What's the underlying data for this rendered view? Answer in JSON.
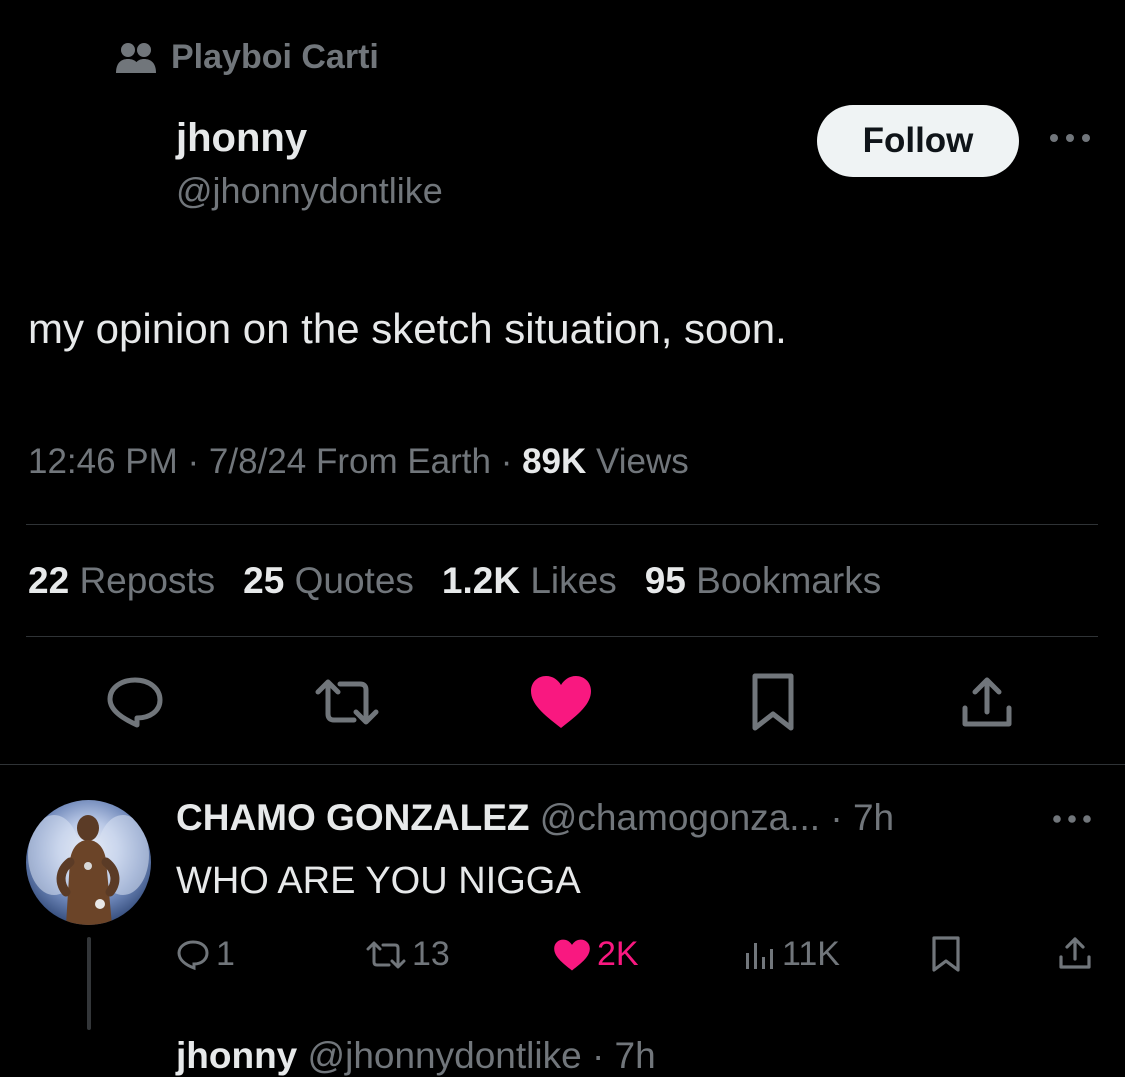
{
  "community": {
    "label": "Playboi Carti",
    "icon": "people-icon"
  },
  "author": {
    "name": "jhonny",
    "handle": "@jhonnydontlike"
  },
  "follow_label": "Follow",
  "tweet": {
    "text": "my opinion on the sketch situation, soon."
  },
  "meta": {
    "time_date_source": "12:46 PM · 7/8/24 From Earth · ",
    "views_count": "89K",
    "views_label": " Views"
  },
  "stats": [
    {
      "count": "22",
      "label": "Reposts"
    },
    {
      "count": "25",
      "label": "Quotes"
    },
    {
      "count": "1.2K",
      "label": "Likes"
    },
    {
      "count": "95",
      "label": "Bookmarks"
    }
  ],
  "actions": {
    "reply_icon": "reply-icon",
    "repost_icon": "repost-icon",
    "like_icon": "heart-icon",
    "bookmark_icon": "bookmark-icon",
    "share_icon": "share-icon",
    "like_color": "#f91880"
  },
  "reply": {
    "name": "CHAMO GONZALEZ",
    "handle_time": " @chamogonza... · 7h",
    "text": "WHO ARE YOU NIGGA",
    "replies": "1",
    "reposts": "13",
    "likes": "2K",
    "views": "11K"
  },
  "next_reply": {
    "name": "jhonny",
    "handle_time": " @jhonnydontlike · 7h"
  }
}
